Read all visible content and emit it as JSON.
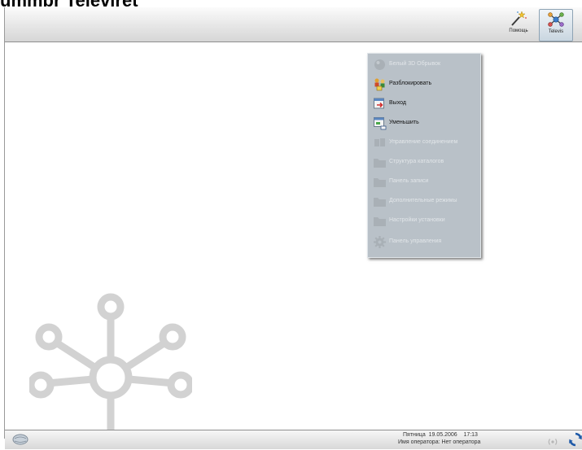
{
  "page_title": "ummbr Televiret",
  "toolbar": {
    "help_label": "Помощь",
    "tools_label": "Televis",
    "help_icon": "magic-wand-icon",
    "tools_icon": "molecule-icon"
  },
  "menu": {
    "items": [
      {
        "label": "Белый 3D Обрывок",
        "enabled": false,
        "icon": "sphere-icon"
      },
      {
        "label": "Разблокировать",
        "enabled": true,
        "icon": "users-unlock-icon"
      },
      {
        "label": "Выход",
        "enabled": true,
        "icon": "exit-icon"
      },
      {
        "label": "Уменьшить",
        "enabled": true,
        "icon": "minimize-icon"
      },
      {
        "label": "Управление соединением",
        "enabled": false,
        "icon": "connection-icon"
      },
      {
        "label": "Структура каталогов",
        "enabled": false,
        "icon": "folder-icon"
      },
      {
        "label": "Панель записи",
        "enabled": false,
        "icon": "folder-icon"
      },
      {
        "label": "Дополнительные режимы",
        "enabled": false,
        "icon": "folder-icon"
      },
      {
        "label": "Настройки установки",
        "enabled": false,
        "icon": "folder-icon"
      },
      {
        "label": "Панель управления",
        "enabled": false,
        "icon": "gear-icon"
      }
    ]
  },
  "status": {
    "day": "Пятница",
    "date": "19.05.2006",
    "time": "17:13",
    "operator_label": "Имя оператора:",
    "operator_value": "Нет оператора"
  },
  "colors": {
    "menu_bg": "#b9c1c8",
    "accent_blue": "#1f5aa8",
    "watermark": "#d2d2d2"
  }
}
